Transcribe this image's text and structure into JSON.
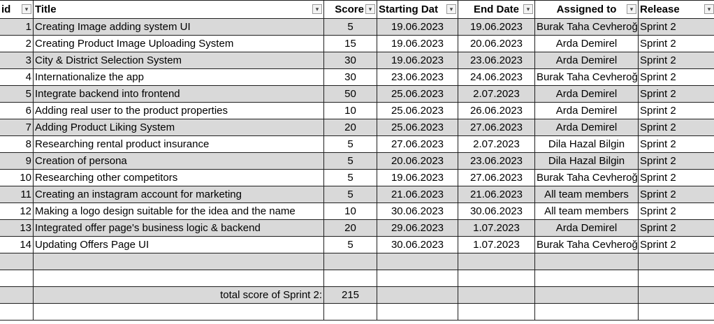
{
  "headers": {
    "id": "id",
    "title": "Title",
    "score": "Score",
    "start": "Starting Dat",
    "end": "End Date",
    "assigned": "Assigned to",
    "release": "Release"
  },
  "icons": {
    "filter": "filter-dropdown-icon",
    "sorted_filter": "sorted-filter-icon"
  },
  "colors": {
    "shaded_row": "#d9d9d9",
    "grid": "#1f1f1f"
  },
  "rows": [
    {
      "id": "1",
      "title": "Creating Image adding system UI",
      "score": "5",
      "start": "19.06.2023",
      "end": "19.06.2023",
      "assigned": "Burak Taha Cevheroğlu",
      "release": "Sprint 2"
    },
    {
      "id": "2",
      "title": "Creating Product Image Uploading System",
      "score": "15",
      "start": "19.06.2023",
      "end": "20.06.2023",
      "assigned": "Arda Demirel",
      "release": "Sprint 2"
    },
    {
      "id": "3",
      "title": "City & District Selection System",
      "score": "30",
      "start": "19.06.2023",
      "end": "23.06.2023",
      "assigned": "Arda Demirel",
      "release": "Sprint 2"
    },
    {
      "id": "4",
      "title": "Internationalize the app",
      "score": "30",
      "start": "23.06.2023",
      "end": "24.06.2023",
      "assigned": "Burak Taha Cevheroğlu",
      "release": "Sprint 2"
    },
    {
      "id": "5",
      "title": "Integrate backend into frontend",
      "score": "50",
      "start": "25.06.2023",
      "end": "2.07.2023",
      "assigned": "Arda Demirel",
      "release": "Sprint 2"
    },
    {
      "id": "6",
      "title": "Adding real user to the product properties",
      "score": "10",
      "start": "25.06.2023",
      "end": "26.06.2023",
      "assigned": "Arda Demirel",
      "release": "Sprint 2"
    },
    {
      "id": "7",
      "title": "Adding Product Liking System",
      "score": "20",
      "start": "25.06.2023",
      "end": "27.06.2023",
      "assigned": "Arda Demirel",
      "release": "Sprint 2"
    },
    {
      "id": "8",
      "title": "Researching rental product insurance",
      "score": "5",
      "start": "27.06.2023",
      "end": "2.07.2023",
      "assigned": "Dila Hazal Bilgin",
      "release": "Sprint 2"
    },
    {
      "id": "9",
      "title": "Creation of persona",
      "score": "5",
      "start": "20.06.2023",
      "end": "23.06.2023",
      "assigned": "Dila Hazal Bilgin",
      "release": "Sprint 2"
    },
    {
      "id": "10",
      "title": "Researching other competitors",
      "score": "5",
      "start": "19.06.2023",
      "end": "27.06.2023",
      "assigned": "Burak Taha Cevheroğlu",
      "release": "Sprint 2"
    },
    {
      "id": "11",
      "title": "Creating an instagram account for marketing",
      "score": "5",
      "start": "21.06.2023",
      "end": "21.06.2023",
      "assigned": "All team members",
      "release": "Sprint 2"
    },
    {
      "id": "12",
      "title": "Making a logo design suitable for the idea and the name",
      "score": "10",
      "start": "30.06.2023",
      "end": "30.06.2023",
      "assigned": "All team members",
      "release": "Sprint 2"
    },
    {
      "id": "13",
      "title": "Integrated offer page's business logic & backend",
      "score": "20",
      "start": "29.06.2023",
      "end": "1.07.2023",
      "assigned": "Arda Demirel",
      "release": "Sprint 2"
    },
    {
      "id": "14",
      "title": "Updating Offers Page UI",
      "score": "5",
      "start": "30.06.2023",
      "end": "1.07.2023",
      "assigned": "Burak Taha Cevheroğlu",
      "release": "Sprint 2"
    }
  ],
  "total": {
    "label": "total score of Sprint 2:",
    "value": "215"
  }
}
